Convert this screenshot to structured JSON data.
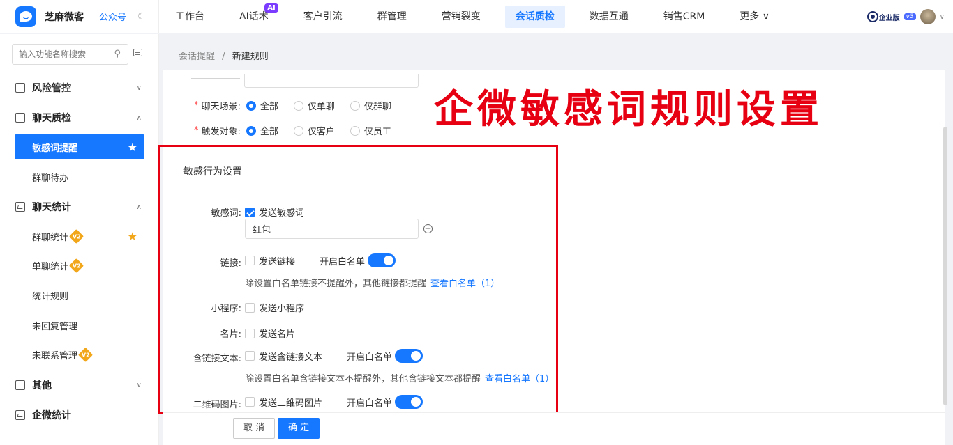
{
  "brand": {
    "name": "芝麻微客",
    "sub": "公众号"
  },
  "nav": {
    "items": [
      {
        "label": "工作台"
      },
      {
        "label": "AI话术",
        "badge": "AI"
      },
      {
        "label": "客户引流"
      },
      {
        "label": "群管理"
      },
      {
        "label": "营销裂变"
      },
      {
        "label": "会话质检",
        "active": true
      },
      {
        "label": "数据互通"
      },
      {
        "label": "销售CRM"
      },
      {
        "label": "更多 ∨"
      }
    ]
  },
  "account": {
    "edition": "企业版",
    "version": "v3"
  },
  "sidebar": {
    "search_placeholder": "输入功能名称搜索",
    "groups": [
      {
        "label": "风险管控"
      },
      {
        "label": "聊天质检"
      },
      {
        "label": "聊天统计"
      },
      {
        "label": "其他"
      },
      {
        "label": "企微统计"
      }
    ],
    "items": [
      {
        "label": "敏感词提醒"
      },
      {
        "label": "群聊待办"
      },
      {
        "label": "群聊统计",
        "badge": "V2"
      },
      {
        "label": "单聊统计",
        "badge": "V2"
      },
      {
        "label": "统计规则"
      },
      {
        "label": "未回复管理"
      },
      {
        "label": "未联系管理",
        "badge": "V2"
      }
    ]
  },
  "breadcrumb": {
    "parent": "会话提醒",
    "separator": "/",
    "current": "新建规则"
  },
  "form": {
    "scene": {
      "label": "聊天场景:",
      "options": [
        "全部",
        "仅单聊",
        "仅群聊"
      ],
      "selected": "全部"
    },
    "target": {
      "label": "触发对象:",
      "options": [
        "全部",
        "仅客户",
        "仅员工"
      ],
      "selected": "全部"
    }
  },
  "behavior": {
    "title": "敏感行为设置",
    "sensitive": {
      "label": "敏感词:",
      "checkbox": "发送敏感词",
      "checked": true,
      "word_value": "红包"
    },
    "link": {
      "label": "链接:",
      "checkbox": "发送链接",
      "checked": false,
      "whitelist_label": "开启白名单",
      "whitelist_on": true,
      "hint": "除设置白名单链接不提醒外，其他链接都提醒",
      "hint_link": "查看白名单（1）"
    },
    "miniprogram": {
      "label": "小程序:",
      "checkbox": "发送小程序",
      "checked": false
    },
    "card": {
      "label": "名片:",
      "checkbox": "发送名片",
      "checked": false
    },
    "linktext": {
      "label": "含链接文本:",
      "checkbox": "发送含链接文本",
      "checked": false,
      "whitelist_label": "开启白名单",
      "whitelist_on": true,
      "hint": "除设置白名单含链接文本不提醒外，其他含链接文本都提醒",
      "hint_link": "查看白名单（1）"
    },
    "qrcode": {
      "label": "二维码图片:",
      "checkbox": "发送二维码图片",
      "checked": false,
      "whitelist_label": "开启白名单",
      "whitelist_on": true
    }
  },
  "overlay_title": "企微敏感词规则设置",
  "footer": {
    "cancel": "取 消",
    "ok": "确 定"
  },
  "colors": {
    "primary": "#1677ff",
    "highlight": "#e60012",
    "badge_v2": "#f2a71a",
    "ai_badge": "#7b3cff"
  }
}
